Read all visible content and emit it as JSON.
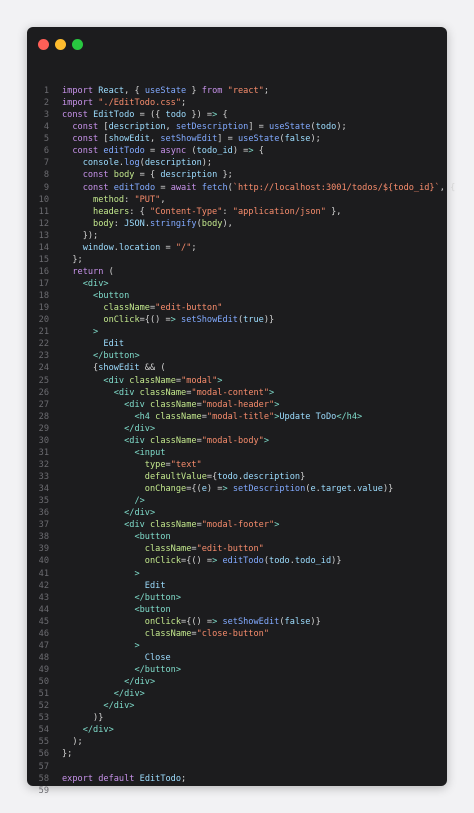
{
  "window": {
    "controls": [
      "close",
      "minimize",
      "zoom"
    ],
    "colors": {
      "close": "#ff5f57",
      "minimize": "#febc2e",
      "zoom": "#28c840",
      "background": "#1c1c1e"
    }
  },
  "code": {
    "lines": [
      {
        "n": "1",
        "t": "import React, { useState } from \"react\";"
      },
      {
        "n": "2",
        "t": "import \"./EditTodo.css\";"
      },
      {
        "n": "3",
        "t": "const EditTodo = ({ todo }) => {"
      },
      {
        "n": "4",
        "t": "  const [description, setDescription] = useState(todo);"
      },
      {
        "n": "5",
        "t": "  const [showEdit, setShowEdit] = useState(false);"
      },
      {
        "n": "6",
        "t": "  const editTodo = async (todo_id) => {"
      },
      {
        "n": "7",
        "t": "    console.log(description);"
      },
      {
        "n": "8",
        "t": "    const body = { description };"
      },
      {
        "n": "9",
        "t": "    const editTodo = await fetch(`http://localhost:3001/todos/${todo_id}`, {"
      },
      {
        "n": "10",
        "t": "      method: \"PUT\","
      },
      {
        "n": "11",
        "t": "      headers: { \"Content-Type\": \"application/json\" },"
      },
      {
        "n": "12",
        "t": "      body: JSON.stringify(body),"
      },
      {
        "n": "13",
        "t": "    });"
      },
      {
        "n": "14",
        "t": "    window.location = \"/\";"
      },
      {
        "n": "15",
        "t": "  };"
      },
      {
        "n": "16",
        "t": "  return ("
      },
      {
        "n": "17",
        "t": "    <div>"
      },
      {
        "n": "18",
        "t": "      <button"
      },
      {
        "n": "19",
        "t": "        className=\"edit-button\""
      },
      {
        "n": "20",
        "t": "        onClick={() => setShowEdit(true)}"
      },
      {
        "n": "21",
        "t": "      >"
      },
      {
        "n": "22",
        "t": "        Edit"
      },
      {
        "n": "23",
        "t": "      </button>"
      },
      {
        "n": "24",
        "t": "      {showEdit && ("
      },
      {
        "n": "25",
        "t": "        <div className=\"modal\">"
      },
      {
        "n": "26",
        "t": "          <div className=\"modal-content\">"
      },
      {
        "n": "27",
        "t": "            <div className=\"modal-header\">"
      },
      {
        "n": "28",
        "t": "              <h4 className=\"modal-title\">Update ToDo</h4>"
      },
      {
        "n": "29",
        "t": "            </div>"
      },
      {
        "n": "30",
        "t": "            <div className=\"modal-body\">"
      },
      {
        "n": "31",
        "t": "              <input"
      },
      {
        "n": "32",
        "t": "                type=\"text\""
      },
      {
        "n": "33",
        "t": "                defaultValue={todo.description}"
      },
      {
        "n": "34",
        "t": "                onChange={(e) => setDescription(e.target.value)}"
      },
      {
        "n": "35",
        "t": "              />"
      },
      {
        "n": "36",
        "t": "            </div>"
      },
      {
        "n": "37",
        "t": "            <div className=\"modal-footer\">"
      },
      {
        "n": "38",
        "t": "              <button"
      },
      {
        "n": "39",
        "t": "                className=\"edit-button\""
      },
      {
        "n": "40",
        "t": "                onClick={() => editTodo(todo.todo_id)}"
      },
      {
        "n": "41",
        "t": "              >"
      },
      {
        "n": "42",
        "t": "                Edit"
      },
      {
        "n": "43",
        "t": "              </button>"
      },
      {
        "n": "44",
        "t": "              <button"
      },
      {
        "n": "45",
        "t": "                onClick={() => setShowEdit(false)}"
      },
      {
        "n": "46",
        "t": "                className=\"close-button\""
      },
      {
        "n": "47",
        "t": "              >"
      },
      {
        "n": "48",
        "t": "                Close"
      },
      {
        "n": "49",
        "t": "              </button>"
      },
      {
        "n": "50",
        "t": "            </div>"
      },
      {
        "n": "51",
        "t": "          </div>"
      },
      {
        "n": "52",
        "t": "        </div>"
      },
      {
        "n": "53",
        "t": "      )}"
      },
      {
        "n": "54",
        "t": "    </div>"
      },
      {
        "n": "55",
        "t": "  );"
      },
      {
        "n": "56",
        "t": "};"
      },
      {
        "n": "57",
        "t": ""
      },
      {
        "n": "58",
        "t": "export default EditTodo;"
      },
      {
        "n": "59",
        "t": ""
      }
    ]
  }
}
